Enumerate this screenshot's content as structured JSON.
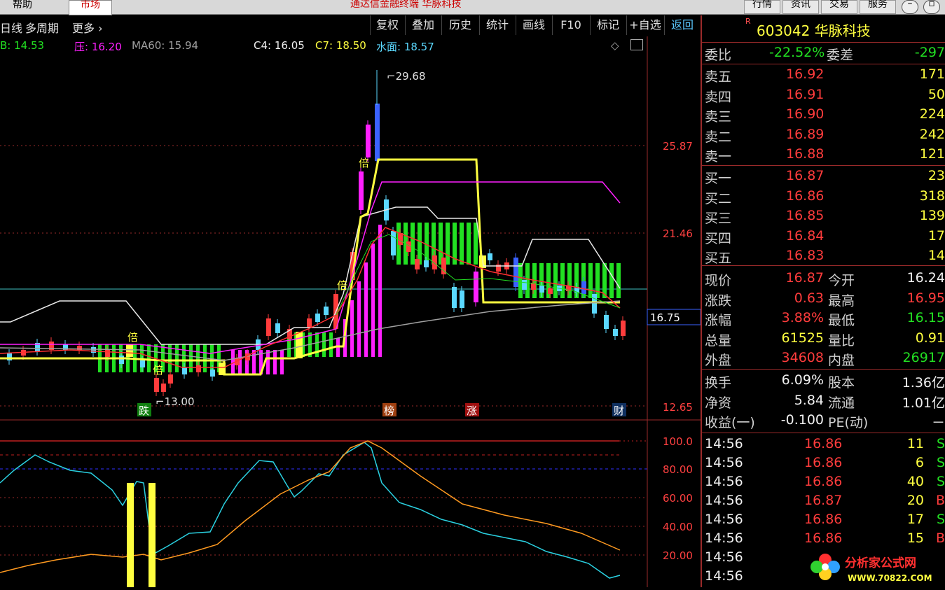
{
  "topbar": {
    "help": "帮助",
    "market": "市场",
    "title": "通达信金融终端 华脉科技",
    "buttons": [
      "行情",
      "资讯",
      "交易",
      "服务"
    ],
    "min_icon": "minimize-icon",
    "restore_icon": "restore-icon"
  },
  "toolbar": {
    "left_items": [
      "日线",
      "多周期",
      "更多"
    ],
    "buttons": [
      "复权",
      "叠加",
      "历史",
      "统计",
      "画线",
      "F10",
      "标记",
      "+自选",
      "返回"
    ]
  },
  "indicators": {
    "b": "B: 14.53",
    "pressure": "压: 16.20",
    "ma60": "MA60: 15.94",
    "c4": "C4: 16.05",
    "c7": "C7: 18.50",
    "water": "水面: 18.57"
  },
  "colors": {
    "up": "#ff3c3c",
    "down": "#5bd8ff",
    "accent": "#ffff40",
    "green": "#22e022",
    "magenta": "#ff20ff"
  },
  "chart_main": {
    "price_labels": [
      "25.87",
      "21.46",
      "16.75",
      "12.65"
    ],
    "current_price_box": "16.75",
    "high_annotation": "29.68",
    "low_annotation": "13.00",
    "markers": [
      "倍",
      "倍",
      "倍",
      "倍"
    ],
    "event_tags": [
      "跌",
      "榜",
      "涨",
      "财"
    ]
  },
  "chart_sub": {
    "y_labels": [
      "100.0",
      "80.00",
      "60.00",
      "40.00",
      "20.00"
    ]
  },
  "panel": {
    "r_mark": "R",
    "code": "603042 华脉科技",
    "webi": {
      "label": "委比",
      "value": "-22.52%",
      "label2": "委差",
      "value2": "-297"
    },
    "sells": [
      {
        "label": "卖五",
        "price": "16.92",
        "vol": "171"
      },
      {
        "label": "卖四",
        "price": "16.91",
        "vol": "50"
      },
      {
        "label": "卖三",
        "price": "16.90",
        "vol": "224"
      },
      {
        "label": "卖二",
        "price": "16.89",
        "vol": "242"
      },
      {
        "label": "卖一",
        "price": "16.88",
        "vol": "121"
      }
    ],
    "buys": [
      {
        "label": "买一",
        "price": "16.87",
        "vol": "23"
      },
      {
        "label": "买二",
        "price": "16.86",
        "vol": "318"
      },
      {
        "label": "买三",
        "price": "16.85",
        "vol": "139"
      },
      {
        "label": "买四",
        "price": "16.84",
        "vol": "17"
      },
      {
        "label": "买五",
        "price": "16.83",
        "vol": "14"
      }
    ],
    "quote": [
      {
        "l1": "现价",
        "v1": "16.87",
        "l2": "今开",
        "v2": "16.24"
      },
      {
        "l1": "涨跌",
        "v1": "0.63",
        "l2": "最高",
        "v2": "16.95"
      },
      {
        "l1": "涨幅",
        "v1": "3.88%",
        "l2": "最低",
        "v2": "16.15"
      },
      {
        "l1": "总量",
        "v1": "61525",
        "l2": "量比",
        "v2": "0.91"
      },
      {
        "l1": "外盘",
        "v1": "34608",
        "l2": "内盘",
        "v2": "26917"
      }
    ],
    "fin": [
      {
        "l1": "换手",
        "v1": "6.09%",
        "l2": "股本",
        "v2": "1.36亿"
      },
      {
        "l1": "净资",
        "v1": "5.84",
        "l2": "流通",
        "v2": "1.01亿"
      },
      {
        "l1": "收益(一)",
        "v1": "-0.100",
        "l2": "PE(动)",
        "v2": "－"
      }
    ],
    "ticks": [
      {
        "time": "14:56",
        "price": "16.86",
        "vol": "11",
        "bs": "S"
      },
      {
        "time": "14:56",
        "price": "16.86",
        "vol": "6",
        "bs": "S"
      },
      {
        "time": "14:56",
        "price": "16.86",
        "vol": "40",
        "bs": "S"
      },
      {
        "time": "14:56",
        "price": "16.87",
        "vol": "20",
        "bs": "B"
      },
      {
        "time": "14:56",
        "price": "16.86",
        "vol": "17",
        "bs": "S"
      },
      {
        "time": "14:56",
        "price": "16.86",
        "vol": "15",
        "bs": "B"
      },
      {
        "time": "14:56",
        "price": "",
        "vol": "",
        "bs": ""
      },
      {
        "time": "14:56",
        "price": "",
        "vol": "",
        "bs": ""
      }
    ],
    "logo_text": "分析家公式网",
    "logo_url": "WWW.70822.COM"
  }
}
